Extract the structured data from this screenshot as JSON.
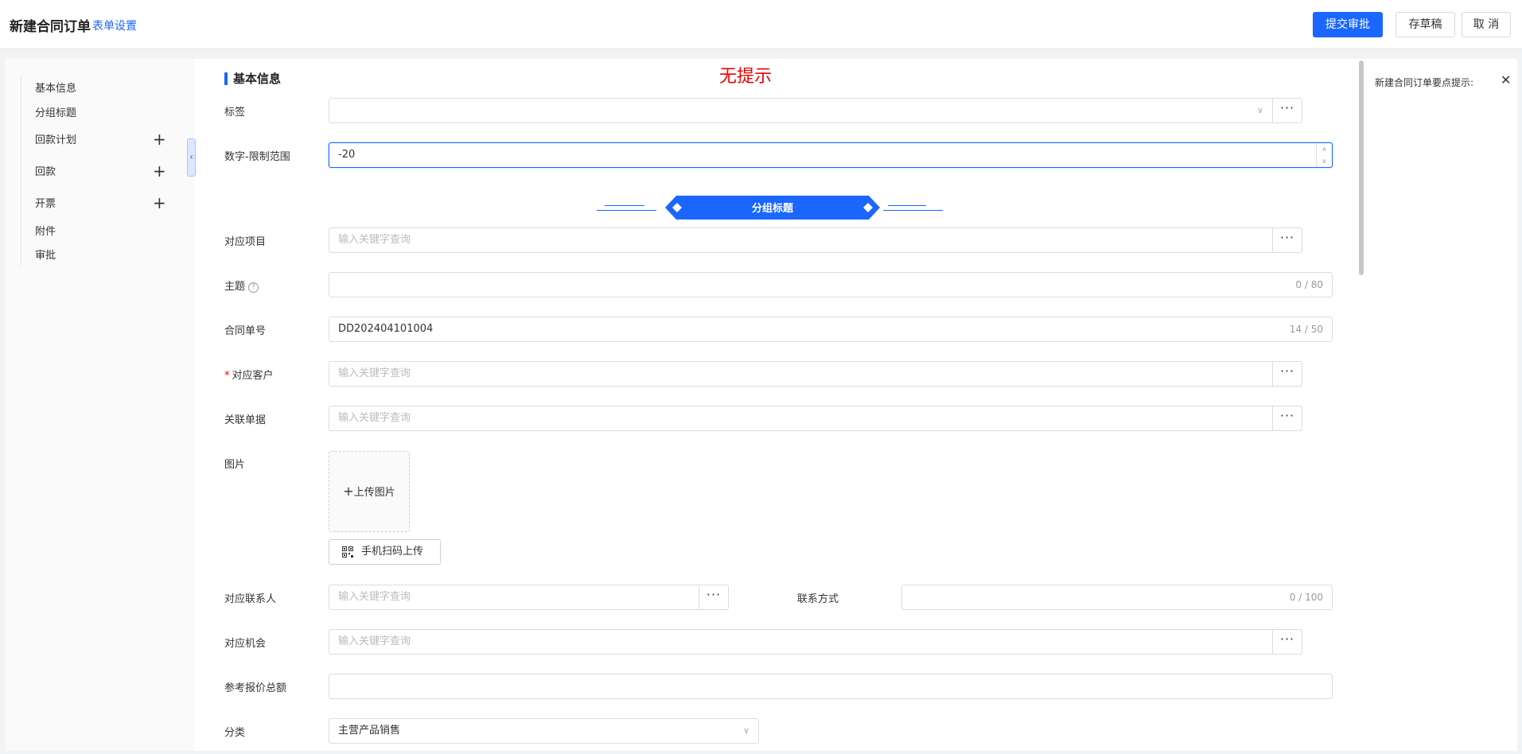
{
  "header": {
    "title": "新建合同订单",
    "form_settings": "表单设置",
    "submit": "提交审批",
    "save_draft": "存草稿",
    "cancel": "取 消"
  },
  "nav": {
    "items": [
      "基本信息",
      "分组标题",
      "回款计划",
      "回款",
      "开票",
      "附件",
      "审批"
    ],
    "plus": "+",
    "collapse": "‹"
  },
  "section": {
    "title": "基本信息",
    "no_tip": "无提示"
  },
  "fields": {
    "tag": {
      "label": "标签"
    },
    "number_range": {
      "label": "数字-限制范围",
      "value": "-20"
    },
    "group_title": "分组标题",
    "project": {
      "label": "对应项目",
      "placeholder": "输入关键字查询"
    },
    "subject": {
      "label": "主题",
      "counter": "0 / 80",
      "help": "?"
    },
    "contract_no": {
      "label": "合同单号",
      "value": "DD202404101004",
      "counter": "14 / 50"
    },
    "customer": {
      "label": "对应客户",
      "required": "*",
      "placeholder": "输入关键字查询"
    },
    "related_doc": {
      "label": "关联单据",
      "placeholder": "输入关键字查询"
    },
    "image": {
      "label": "图片",
      "upload": "上传图片",
      "upload_plus": "+",
      "scan_upload": "手机扫码上传"
    },
    "contact": {
      "label": "对应联系人",
      "placeholder": "输入关键字查询"
    },
    "contact_method": {
      "label": "联系方式",
      "counter": "0 / 100"
    },
    "opportunity": {
      "label": "对应机会",
      "placeholder": "输入关键字查询"
    },
    "quote_total": {
      "label": "参考报价总额"
    },
    "category": {
      "label": "分类",
      "value": "主营产品销售"
    }
  },
  "glyphs": {
    "dots": "···",
    "chevron": "∨",
    "up": "∧",
    "down": "∨"
  },
  "tips": {
    "title": "新建合同订单要点提示:",
    "close": "✕"
  },
  "colors": {
    "accent": "#1a66ff",
    "required": "#e00000",
    "no_tip": "#e00000"
  }
}
